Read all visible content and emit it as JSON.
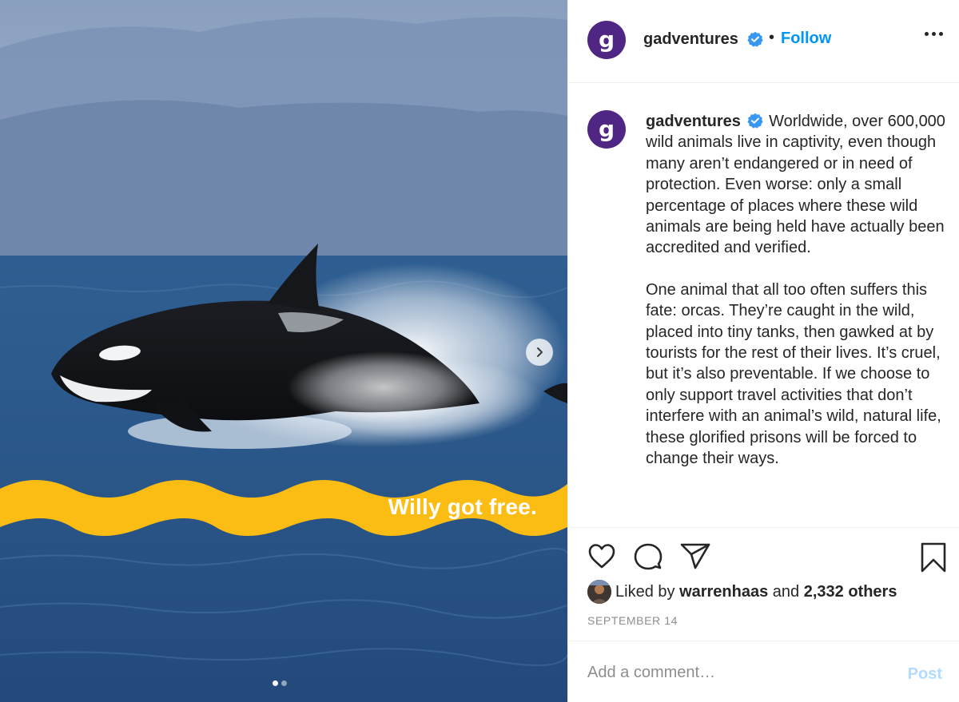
{
  "media": {
    "overlay_text": "Willy got free.",
    "carousel": {
      "slides": 2,
      "active": 1
    },
    "colors": {
      "banner": "#fbbd13",
      "sea": "#2e5d8c"
    }
  },
  "header": {
    "username": "gadventures",
    "separator": "•",
    "follow_label": "Follow",
    "avatar_letter": "g",
    "verified_icon": "verified-badge-icon",
    "more_icon": "more-options-icon"
  },
  "caption": {
    "username": "gadventures",
    "paragraph1": "Worldwide, over 600,000 wild animals live in captivity, even though many aren’t endangered or in need of protection. Even worse: only a small percentage of places where these wild animals are being held have actually been accredited and verified.",
    "paragraph2": "One animal that all too often suffers this fate: orcas. They’re caught in the wild, placed into tiny tanks, then gawked at by tourists for the rest of their lives. It’s cruel, but it’s also preventable. If we choose to only support travel activities that don’t interfere with an animal’s wild, natural life, these glorified prisons will be forced to change their ways."
  },
  "actions": {
    "icons": [
      "heart-icon",
      "comment-icon",
      "share-icon",
      "bookmark-icon"
    ],
    "liked_by_prefix": "Liked by",
    "liked_by_user": "warrenhaas",
    "liked_by_and": "and",
    "liked_by_others": "2,332 others",
    "date": "SEPTEMBER 14"
  },
  "comment": {
    "placeholder": "Add a comment…",
    "post_label": "Post"
  },
  "colors": {
    "brand": "#4f2683",
    "follow": "#0095f6",
    "verified": "#3897f0",
    "post_disabled": "#b3dbff"
  }
}
